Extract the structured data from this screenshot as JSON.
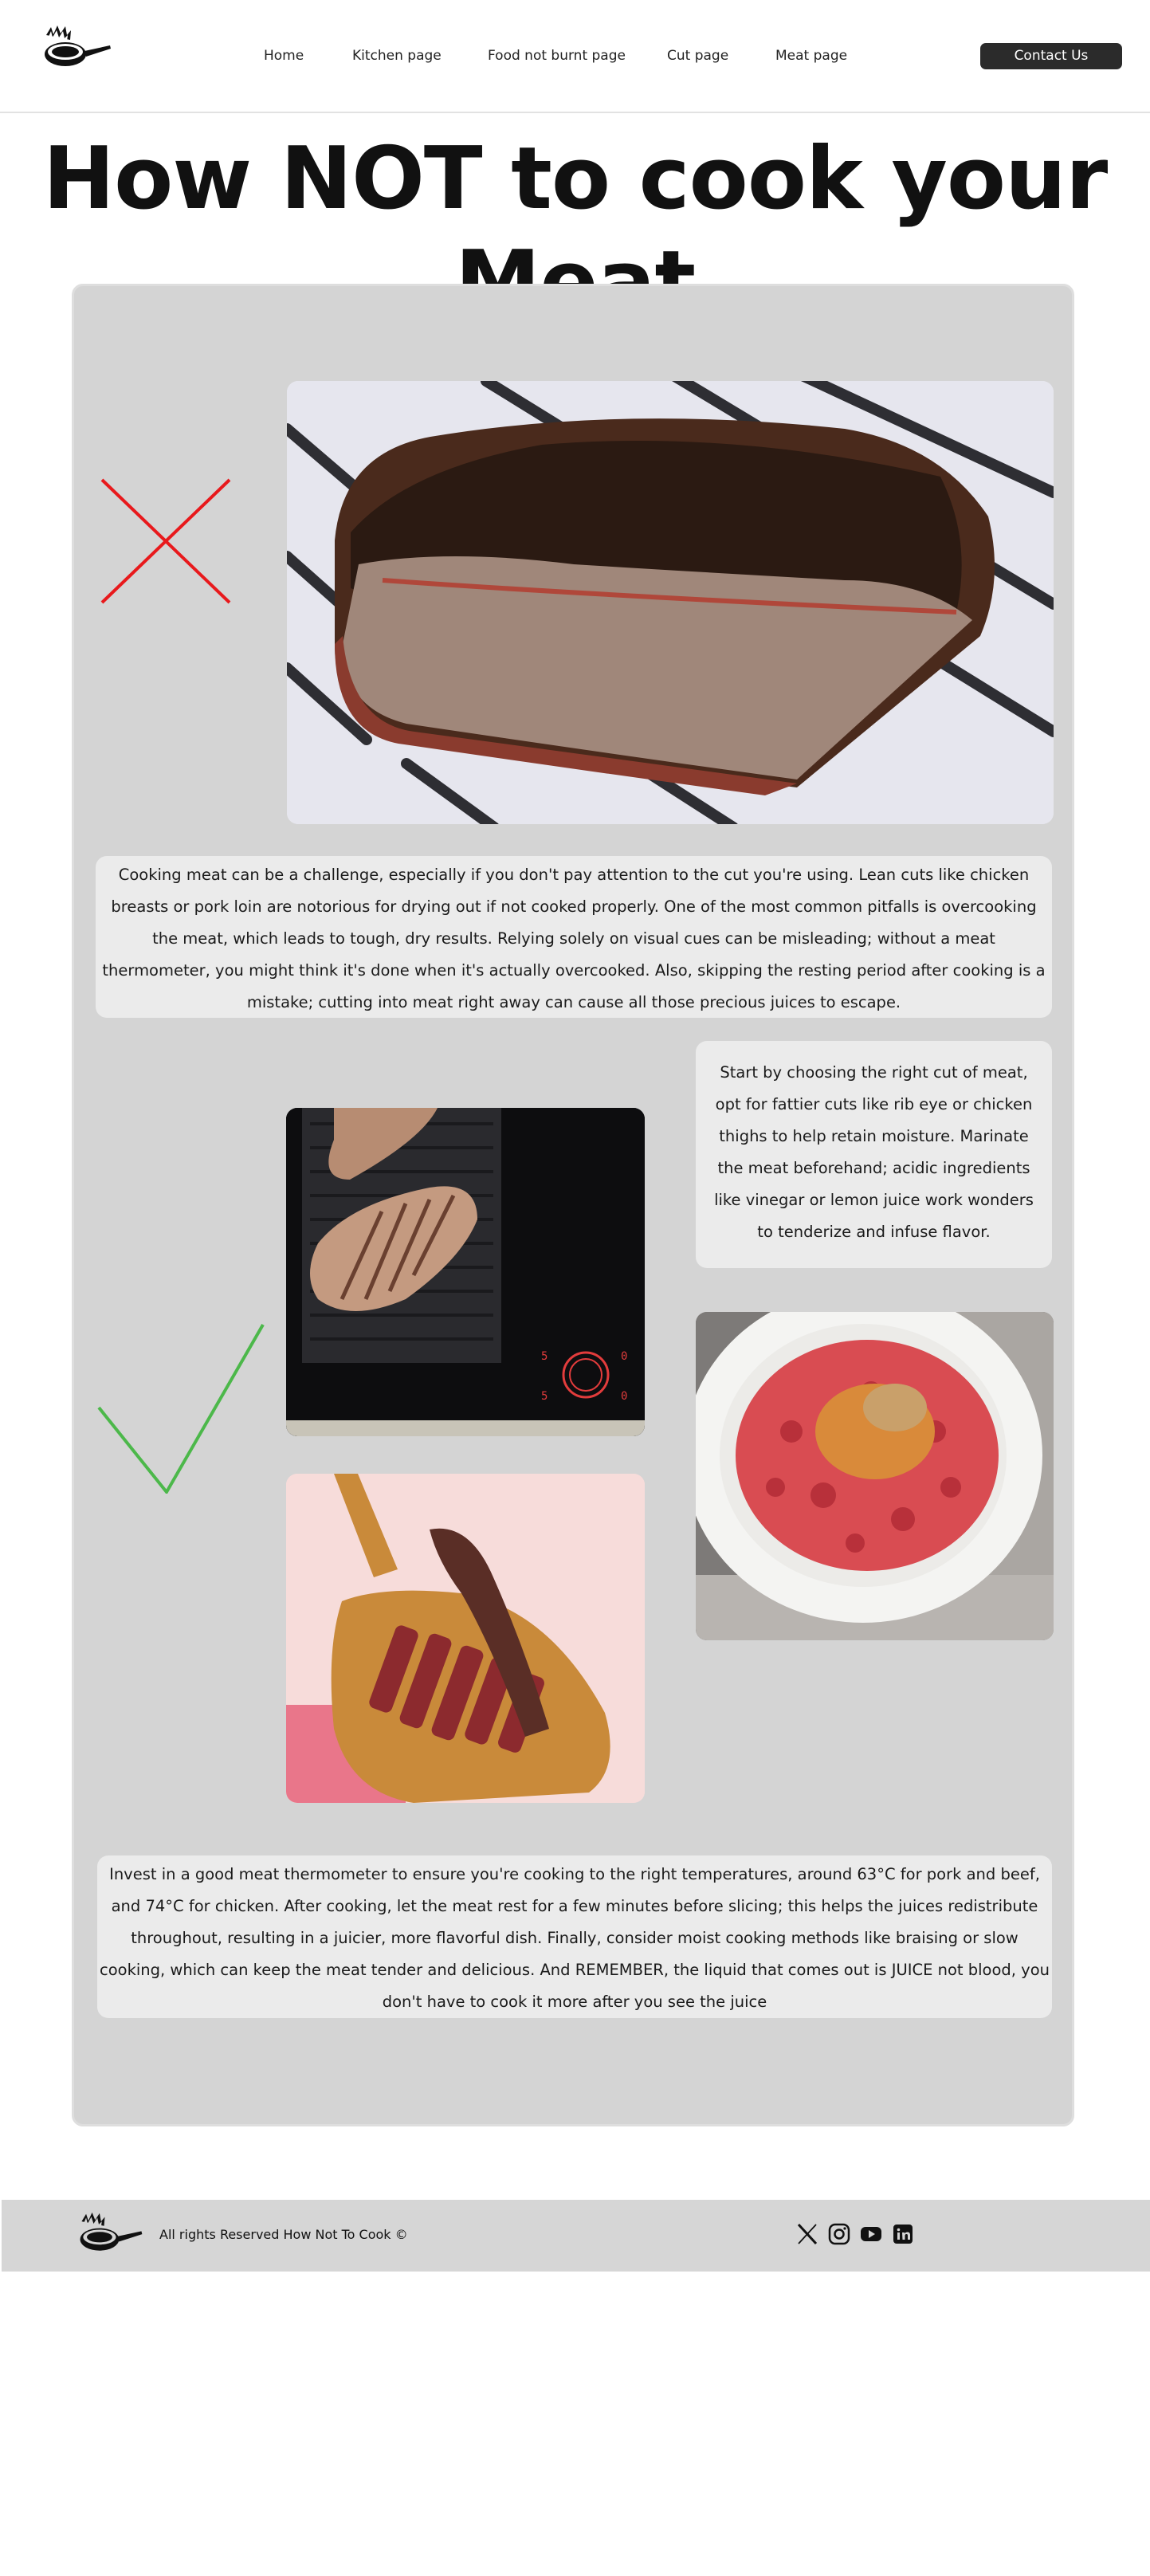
{
  "header": {
    "logo_icon": "flaming-pan-logo",
    "nav": [
      {
        "label": "Home"
      },
      {
        "label": "Kitchen page"
      },
      {
        "label": "Food not burnt page"
      },
      {
        "label": "Cut page"
      },
      {
        "label": "Meat page"
      }
    ],
    "contact_label": "Contact Us"
  },
  "page_title": "How NOT to cook your Meat",
  "section_bad": {
    "marker_icon": "red-x-icon",
    "photo": "overcooked-steak-on-grill-photo",
    "text": "Cooking meat can be a challenge, especially if you don't pay attention to the cut you're using. Lean cuts like chicken breasts or pork loin are notorious for drying out if not cooked properly. One of the most common pitfalls is overcooking the meat, which leads to tough, dry results. Relying solely on visual cues can be misleading; without a meat thermometer, you might think it's done when it's actually overcooked. Also, skipping the resting period after cooking is a mistake; cutting into meat right away can cause all those precious juices to escape."
  },
  "section_good": {
    "marker_icon": "green-check-icon",
    "photos": [
      "steak-on-griddle-photo",
      "sliced-steak-on-board-photo",
      "seasoned-ground-meat-photo"
    ],
    "tip_text": "Start by choosing the right cut of meat, opt for fattier cuts like rib eye or chicken thighs to help retain moisture. Marinate the meat beforehand; acidic ingredients like vinegar or lemon juice work wonders to tenderize and infuse flavor.",
    "text": "Invest in a good meat thermometer to ensure you're cooking to the right temperatures, around 63°C for pork and beef, and 74°C for chicken. After cooking, let the meat rest for a few minutes before slicing; this helps the juices redistribute throughout, resulting in a juicier, more flavorful dish. Finally, consider moist cooking methods like braising or slow cooking, which can keep the meat tender and delicious. And REMEMBER, the liquid that comes out is JUICE not blood, you don't have to cook it more after you see the juice"
  },
  "footer": {
    "copyright": "All rights Reserved How Not To Cook ©",
    "social_icons": [
      "x-icon",
      "instagram-icon",
      "youtube-icon",
      "linkedin-icon"
    ]
  },
  "colors": {
    "card_bg": "#d4d4d4",
    "textbox_bg": "#ebebeb",
    "button_bg": "#2b2b2b",
    "cross": "#e8191c",
    "check": "#4cb84a"
  }
}
